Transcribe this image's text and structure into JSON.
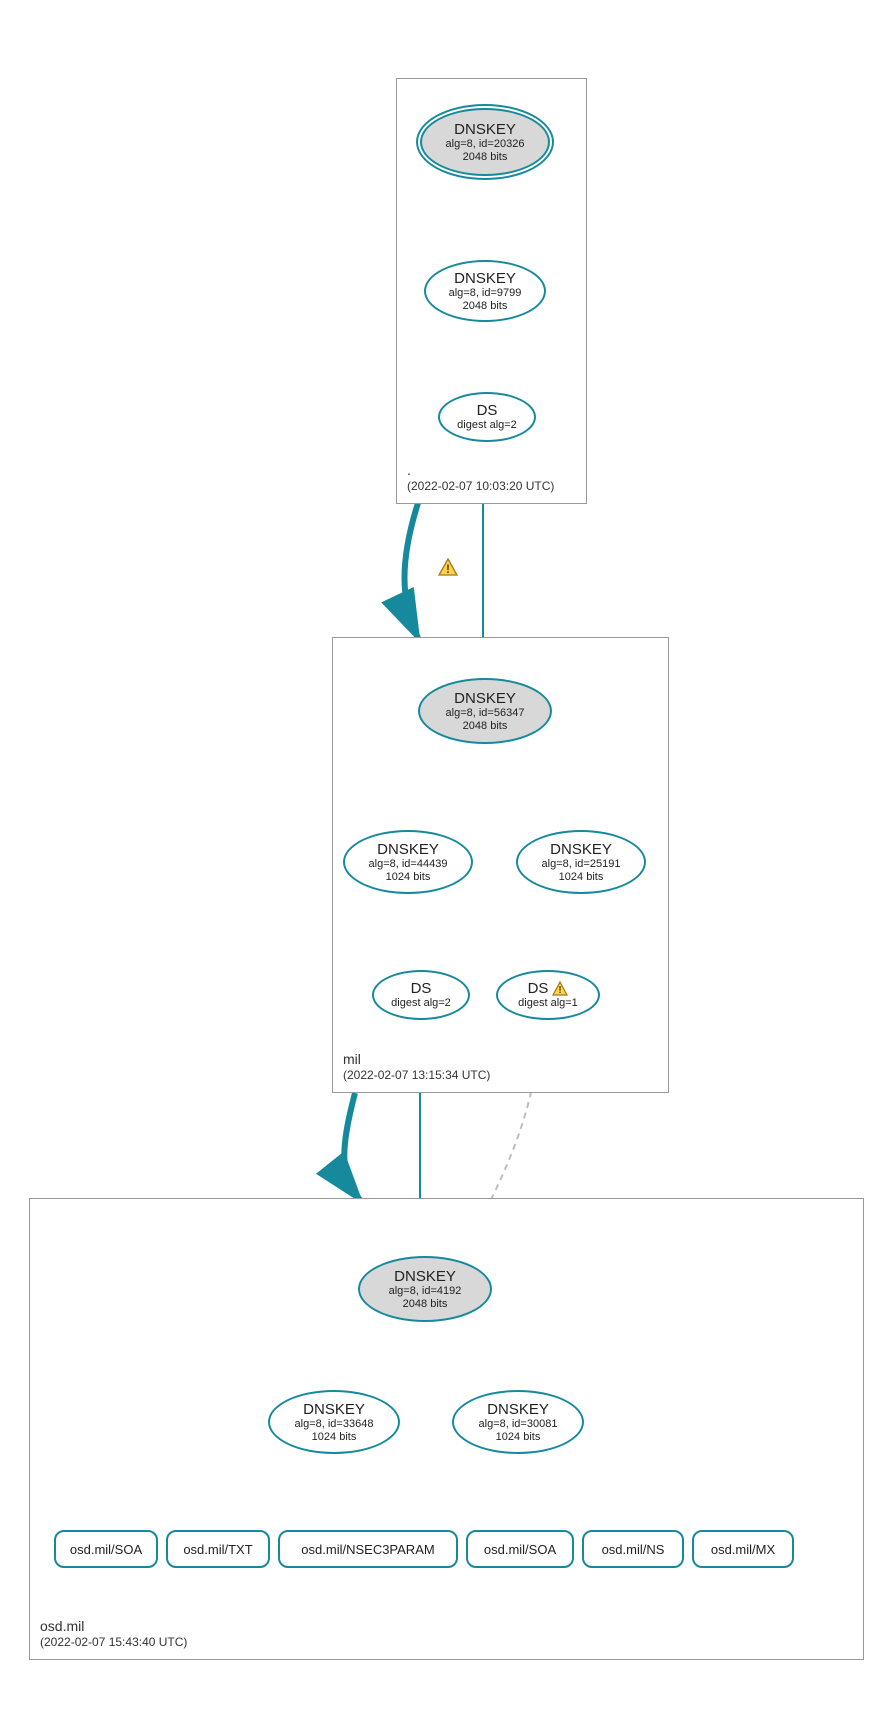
{
  "colors": {
    "stroke": "#168a9c",
    "ksk_fill": "#d8d8d8",
    "warn_fill": "#ffd24a",
    "warn_stroke": "#a0781a",
    "dashed": "#bdbdbd"
  },
  "zones": {
    "root": {
      "name": ".",
      "timestamp": "(2022-02-07 10:03:20 UTC)"
    },
    "mil": {
      "name": "mil",
      "timestamp": "(2022-02-07 13:15:34 UTC)"
    },
    "osd": {
      "name": "osd.mil",
      "timestamp": "(2022-02-07 15:43:40 UTC)"
    }
  },
  "nodes": {
    "root_ksk": {
      "title": "DNSKEY",
      "line2": "alg=8, id=20326",
      "line3": "2048 bits"
    },
    "root_zsk": {
      "title": "DNSKEY",
      "line2": "alg=8, id=9799",
      "line3": "2048 bits"
    },
    "root_ds": {
      "title": "DS",
      "line2": "digest alg=2"
    },
    "mil_ksk": {
      "title": "DNSKEY",
      "line2": "alg=8, id=56347",
      "line3": "2048 bits"
    },
    "mil_zsk1": {
      "title": "DNSKEY",
      "line2": "alg=8, id=44439",
      "line3": "1024 bits"
    },
    "mil_zsk2": {
      "title": "DNSKEY",
      "line2": "alg=8, id=25191",
      "line3": "1024 bits"
    },
    "mil_ds1": {
      "title": "DS",
      "line2": "digest alg=2"
    },
    "mil_ds2": {
      "title": "DS",
      "line2": "digest alg=1"
    },
    "osd_ksk": {
      "title": "DNSKEY",
      "line2": "alg=8, id=4192",
      "line3": "2048 bits"
    },
    "osd_zsk1": {
      "title": "DNSKEY",
      "line2": "alg=8, id=33648",
      "line3": "1024 bits"
    },
    "osd_zsk2": {
      "title": "DNSKEY",
      "line2": "alg=8, id=30081",
      "line3": "1024 bits"
    }
  },
  "rrs": {
    "r1": "osd.mil/SOA",
    "r2": "osd.mil/TXT",
    "r3": "osd.mil/NSEC3PARAM",
    "r4": "osd.mil/SOA",
    "r5": "osd.mil/NS",
    "r6": "osd.mil/MX"
  }
}
